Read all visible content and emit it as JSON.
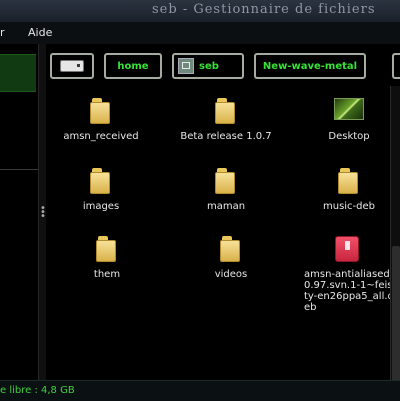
{
  "window": {
    "title": "seb - Gestionnaire de fichiers"
  },
  "menu": {
    "items": [
      "r",
      "Aide"
    ]
  },
  "pathbar": {
    "buttons": [
      {
        "label": "",
        "icon": "drive-icon"
      },
      {
        "label": "home"
      },
      {
        "label": "seb",
        "icon": "home-folder-icon"
      },
      {
        "label": "New-wave-metal"
      }
    ]
  },
  "files": [
    {
      "name": "amsn_received",
      "icon": "folder-icon"
    },
    {
      "name": "Beta release 1.0.7",
      "icon": "folder-icon"
    },
    {
      "name": "Desktop",
      "icon": "desktop-icon"
    },
    {
      "name": "images",
      "icon": "folder-icon"
    },
    {
      "name": "maman",
      "icon": "folder-icon"
    },
    {
      "name": "music-deb",
      "icon": "folder-icon"
    },
    {
      "name": "them",
      "icon": "folder-icon"
    },
    {
      "name": "videos",
      "icon": "folder-icon"
    },
    {
      "name": "amsn-antialiased_0.97.svn.1-1~feisty-en26ppa5_all.deb",
      "icon": "package-icon"
    }
  ],
  "status": {
    "text": "e libre : 4,8 GB"
  },
  "colors": {
    "accent_green": "#35e235",
    "folder_yellow": "#e9c75a",
    "package_red": "#d83248"
  }
}
